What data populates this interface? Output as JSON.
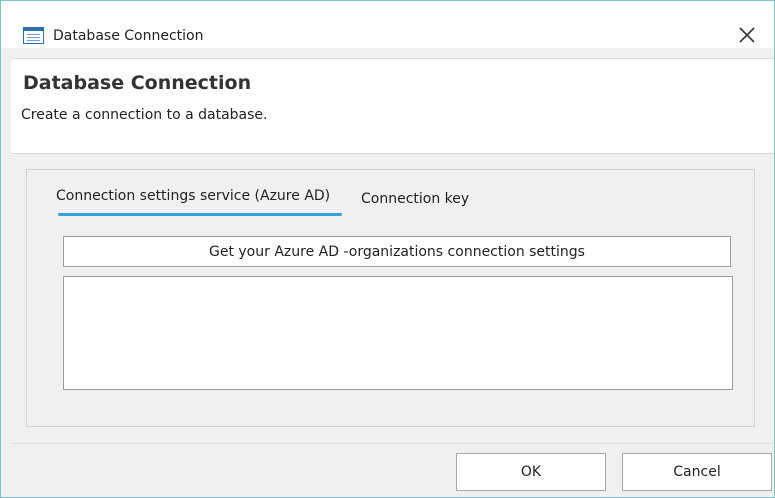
{
  "window": {
    "title": "Database Connection",
    "app_icon": "window-icon",
    "close_icon": "close-icon"
  },
  "header": {
    "title": "Database Connection",
    "subtitle": "Create a connection to a database."
  },
  "tabs": [
    {
      "label": "Connection settings service (Azure AD)",
      "active": true
    },
    {
      "label": "Connection key",
      "active": false
    }
  ],
  "content": {
    "get_settings_label": "Get your Azure AD -organizations connection settings",
    "settings_value": ""
  },
  "footer": {
    "ok_label": "OK",
    "cancel_label": "Cancel"
  },
  "colors": {
    "accent": "#3aa0d8",
    "window_border": "#79c7c9"
  }
}
